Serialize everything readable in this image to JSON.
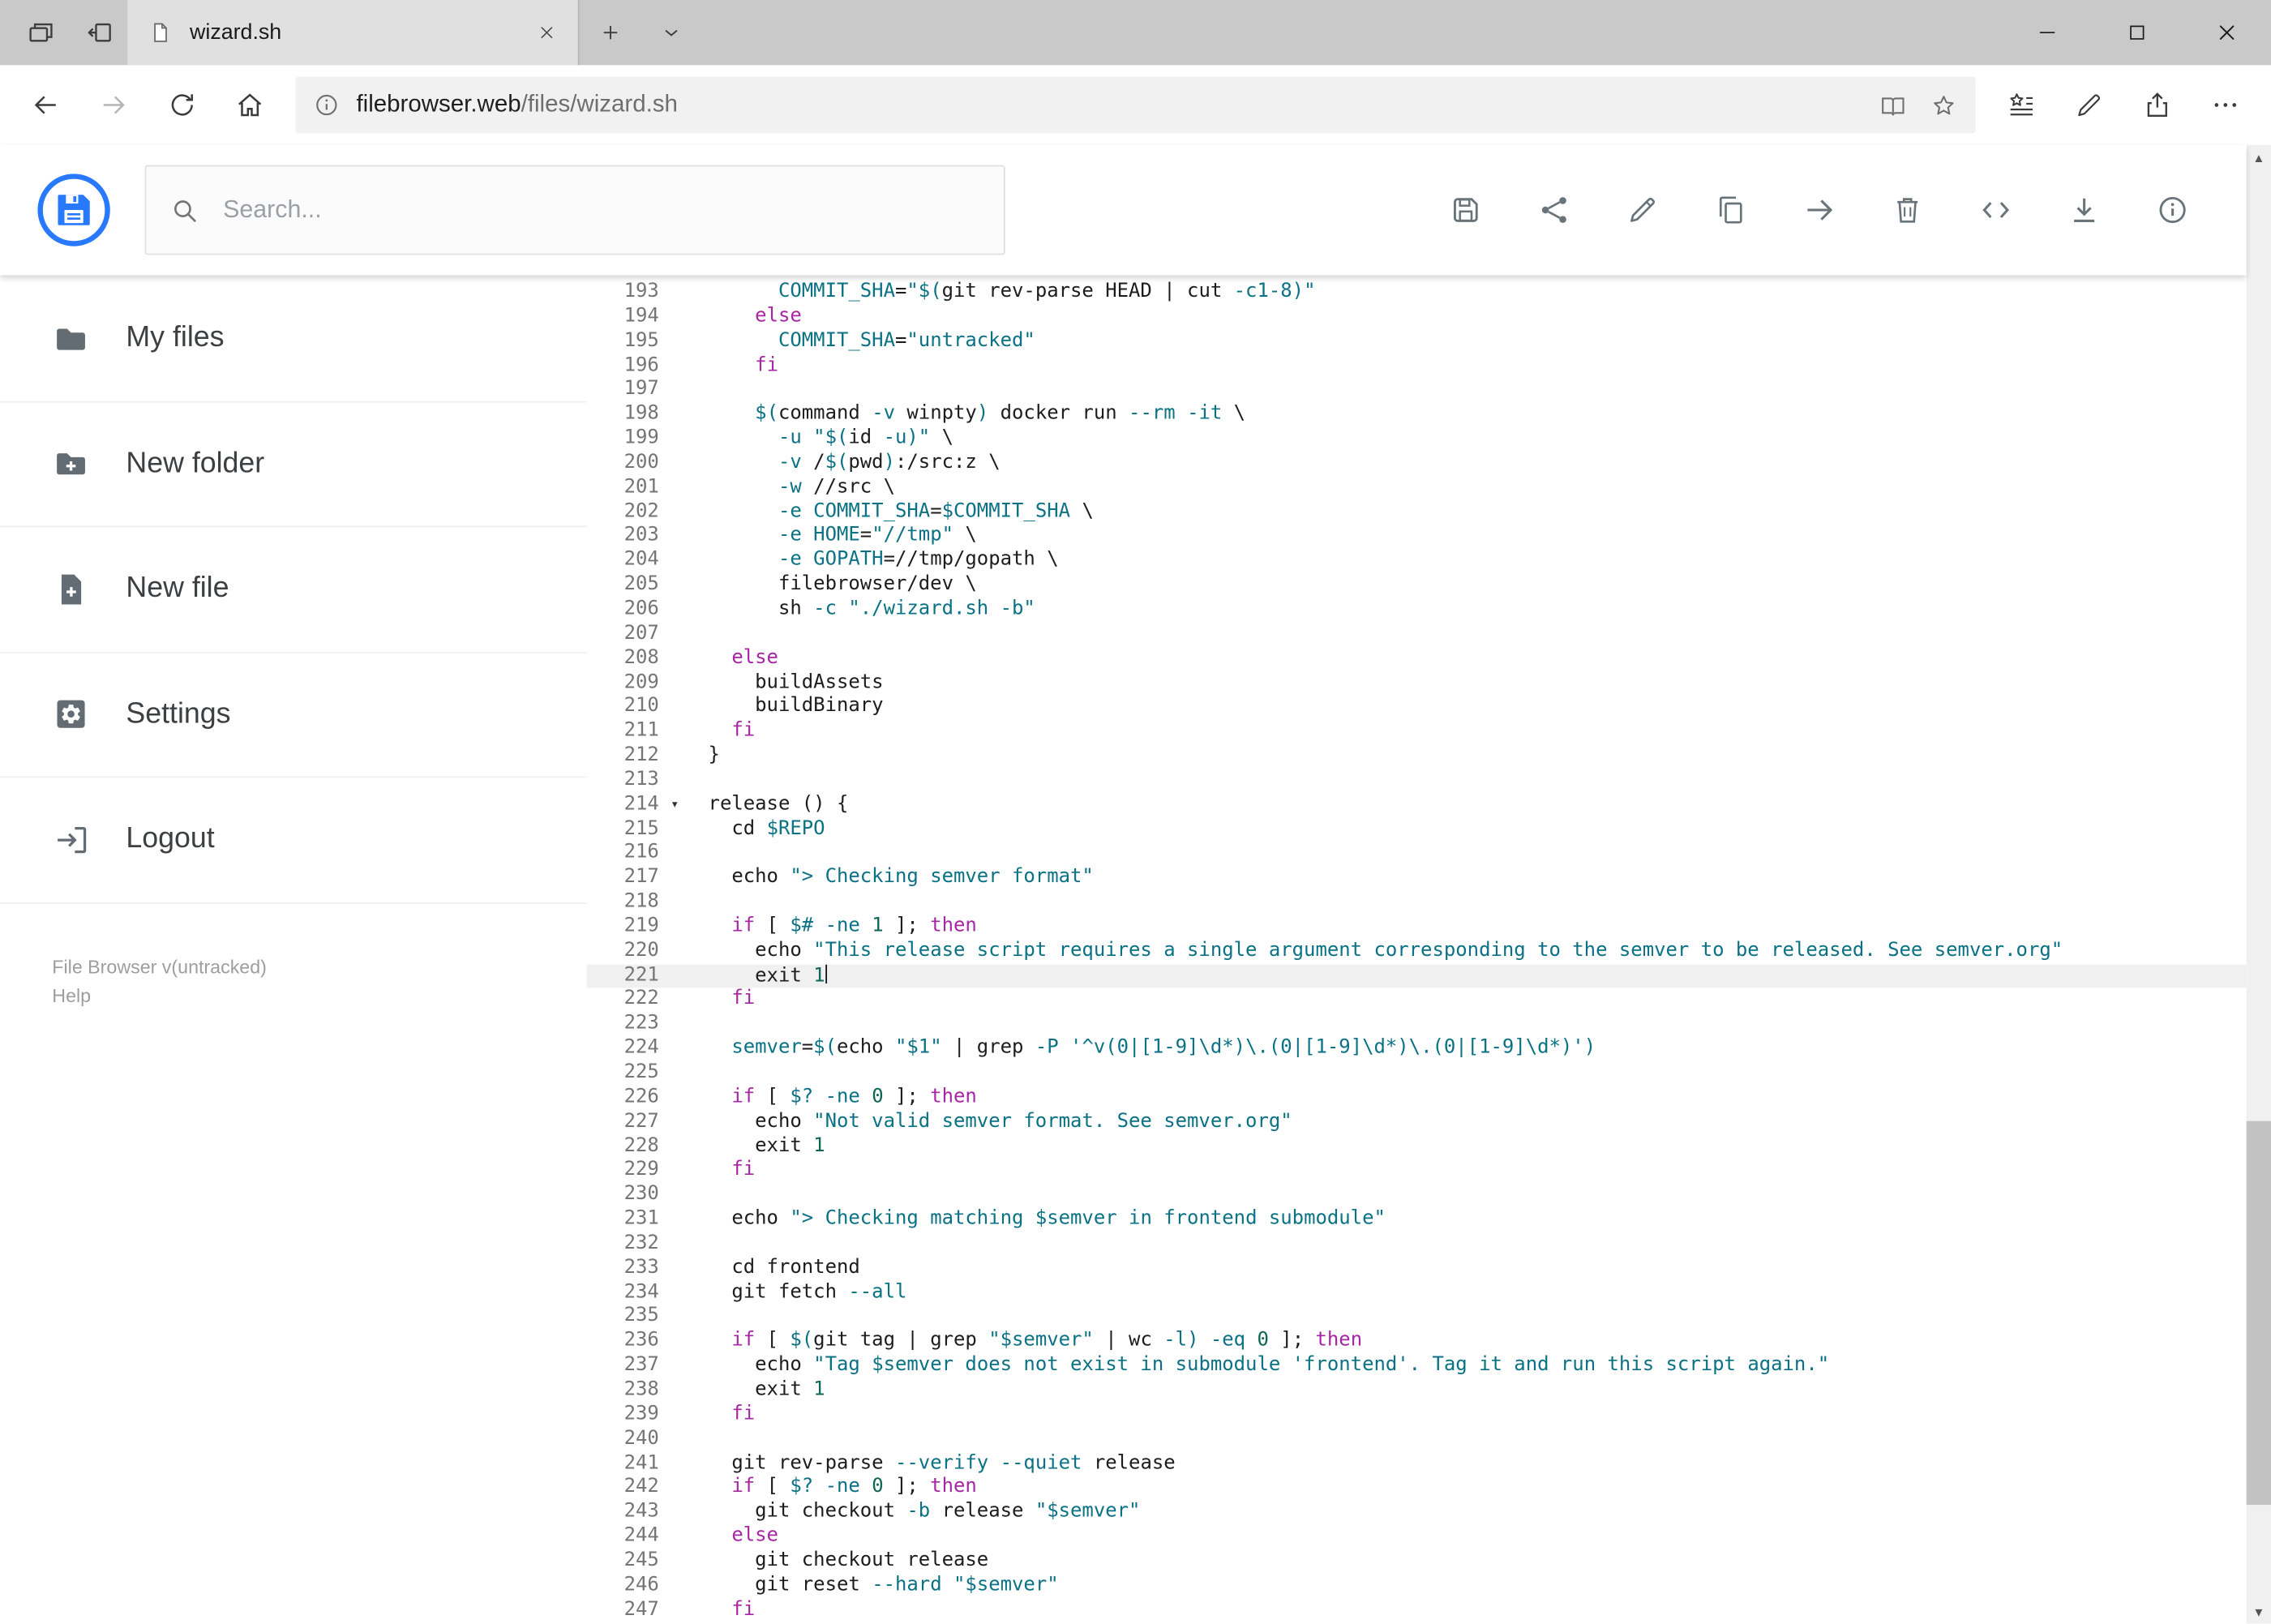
{
  "theme": {
    "accent": "#2979ff",
    "icon_gray": "#69737a",
    "keyword": "#a626a4",
    "string": "#0b7285",
    "variable": "#0b7285",
    "number": "#0e6655",
    "plain": "#1d1d1d",
    "active_line": "#f0f0f0"
  },
  "browser": {
    "tab_title": "wizard.sh",
    "url_host": "filebrowser.web",
    "url_path": "/files/wizard.sh",
    "tab_strip_icons": [
      {
        "name": "tab-preview-button",
        "icon": "tabs-stack"
      },
      {
        "name": "set-tabs-aside-button",
        "icon": "tab-aside"
      }
    ],
    "tab_new_icons": [
      {
        "name": "new-tab-button",
        "icon": "plus"
      },
      {
        "name": "tab-list-button",
        "icon": "chevron-down"
      }
    ],
    "window_icons": [
      {
        "name": "minimize-button",
        "icon": "minimize"
      },
      {
        "name": "maximize-button",
        "icon": "maximize"
      },
      {
        "name": "close-window-button",
        "icon": "close"
      }
    ],
    "nav_icons": [
      {
        "name": "back-button",
        "icon": "back"
      },
      {
        "name": "forward-button",
        "icon": "forward",
        "disabled": true
      },
      {
        "name": "refresh-button",
        "icon": "refresh"
      },
      {
        "name": "home-button",
        "icon": "home"
      }
    ],
    "action_icons": [
      {
        "name": "hub-favorites-button",
        "icon": "hub"
      },
      {
        "name": "web-note-button",
        "icon": "pen"
      },
      {
        "name": "share-page-button",
        "icon": "share-chrome"
      },
      {
        "name": "more-button",
        "icon": "ellipsis"
      }
    ]
  },
  "app": {
    "search_placeholder": "Search...",
    "toolbar": [
      {
        "name": "save-button",
        "icon": "save"
      },
      {
        "name": "share-button",
        "icon": "share"
      },
      {
        "name": "edit-button",
        "icon": "edit"
      },
      {
        "name": "copy-button",
        "icon": "copy"
      },
      {
        "name": "move-button",
        "icon": "move"
      },
      {
        "name": "delete-button",
        "icon": "delete"
      },
      {
        "name": "source-button",
        "icon": "code"
      },
      {
        "name": "download-button",
        "icon": "download"
      },
      {
        "name": "info-button",
        "icon": "info"
      }
    ],
    "sidebar": {
      "items": [
        {
          "id": "my-files",
          "icon": "folder",
          "label": "My files"
        },
        {
          "id": "new-folder",
          "icon": "folder-plus",
          "label": "New folder"
        },
        {
          "id": "new-file",
          "icon": "file-plus",
          "label": "New file"
        },
        {
          "id": "settings",
          "icon": "settings",
          "label": "Settings"
        },
        {
          "id": "logout",
          "icon": "logout",
          "label": "Logout"
        }
      ],
      "footer_version": "File Browser v(untracked)",
      "footer_help": "Help"
    }
  },
  "editor": {
    "active_line": 221,
    "cursor_line": 221,
    "fold_lines": [
      214
    ],
    "lines": [
      {
        "n": 193,
        "t": [
          [
            "p",
            "      "
          ],
          [
            "v",
            "COMMIT_SHA"
          ],
          [
            "p",
            "="
          ],
          [
            "s",
            "\"$("
          ],
          [
            "p",
            "git rev-parse HEAD | cut "
          ],
          [
            "v",
            "-c1-8"
          ],
          [
            "s",
            ")\""
          ]
        ]
      },
      {
        "n": 194,
        "t": [
          [
            "p",
            "    "
          ],
          [
            "k",
            "else"
          ]
        ]
      },
      {
        "n": 195,
        "t": [
          [
            "p",
            "      "
          ],
          [
            "v",
            "COMMIT_SHA"
          ],
          [
            "p",
            "="
          ],
          [
            "s",
            "\"untracked\""
          ]
        ]
      },
      {
        "n": 196,
        "t": [
          [
            "p",
            "    "
          ],
          [
            "k",
            "fi"
          ]
        ]
      },
      {
        "n": 197,
        "t": []
      },
      {
        "n": 198,
        "t": [
          [
            "p",
            "    "
          ],
          [
            "v",
            "$("
          ],
          [
            "p",
            "command "
          ],
          [
            "v",
            "-v"
          ],
          [
            "p",
            " winpty"
          ],
          [
            "v",
            ")"
          ],
          [
            "p",
            " docker run "
          ],
          [
            "v",
            "--rm"
          ],
          [
            "p",
            " "
          ],
          [
            "v",
            "-it"
          ],
          [
            "p",
            " \\"
          ]
        ]
      },
      {
        "n": 199,
        "t": [
          [
            "p",
            "      "
          ],
          [
            "v",
            "-u"
          ],
          [
            "p",
            " "
          ],
          [
            "s",
            "\"$("
          ],
          [
            "p",
            "id "
          ],
          [
            "v",
            "-u"
          ],
          [
            "s",
            ")\""
          ],
          [
            "p",
            " \\"
          ]
        ]
      },
      {
        "n": 200,
        "t": [
          [
            "p",
            "      "
          ],
          [
            "v",
            "-v"
          ],
          [
            "p",
            " /"
          ],
          [
            "v",
            "$("
          ],
          [
            "p",
            "pwd"
          ],
          [
            "v",
            ")"
          ],
          [
            "p",
            ":/src:z \\"
          ]
        ]
      },
      {
        "n": 201,
        "t": [
          [
            "p",
            "      "
          ],
          [
            "v",
            "-w"
          ],
          [
            "p",
            " //src \\"
          ]
        ]
      },
      {
        "n": 202,
        "t": [
          [
            "p",
            "      "
          ],
          [
            "v",
            "-e"
          ],
          [
            "p",
            " "
          ],
          [
            "v",
            "COMMIT_SHA"
          ],
          [
            "p",
            "="
          ],
          [
            "v",
            "$COMMIT_SHA"
          ],
          [
            "p",
            " \\"
          ]
        ]
      },
      {
        "n": 203,
        "t": [
          [
            "p",
            "      "
          ],
          [
            "v",
            "-e"
          ],
          [
            "p",
            " "
          ],
          [
            "v",
            "HOME"
          ],
          [
            "p",
            "="
          ],
          [
            "s",
            "\"//tmp\""
          ],
          [
            "p",
            " \\"
          ]
        ]
      },
      {
        "n": 204,
        "t": [
          [
            "p",
            "      "
          ],
          [
            "v",
            "-e"
          ],
          [
            "p",
            " "
          ],
          [
            "v",
            "GOPATH"
          ],
          [
            "p",
            "=//tmp/gopath \\"
          ]
        ]
      },
      {
        "n": 205,
        "t": [
          [
            "p",
            "      filebrowser/dev \\"
          ]
        ]
      },
      {
        "n": 206,
        "t": [
          [
            "p",
            "      sh "
          ],
          [
            "v",
            "-c"
          ],
          [
            "p",
            " "
          ],
          [
            "s",
            "\"./wizard.sh -b\""
          ]
        ]
      },
      {
        "n": 207,
        "t": []
      },
      {
        "n": 208,
        "t": [
          [
            "p",
            "  "
          ],
          [
            "k",
            "else"
          ]
        ]
      },
      {
        "n": 209,
        "t": [
          [
            "p",
            "    buildAssets"
          ]
        ]
      },
      {
        "n": 210,
        "t": [
          [
            "p",
            "    buildBinary"
          ]
        ]
      },
      {
        "n": 211,
        "t": [
          [
            "p",
            "  "
          ],
          [
            "k",
            "fi"
          ]
        ]
      },
      {
        "n": 212,
        "t": [
          [
            "p",
            "}"
          ]
        ]
      },
      {
        "n": 213,
        "t": []
      },
      {
        "n": 214,
        "t": [
          [
            "p",
            "release () {"
          ]
        ]
      },
      {
        "n": 215,
        "t": [
          [
            "p",
            "  cd "
          ],
          [
            "v",
            "$REPO"
          ]
        ]
      },
      {
        "n": 216,
        "t": []
      },
      {
        "n": 217,
        "t": [
          [
            "p",
            "  echo "
          ],
          [
            "s",
            "\"> Checking semver format\""
          ]
        ]
      },
      {
        "n": 218,
        "t": []
      },
      {
        "n": 219,
        "t": [
          [
            "p",
            "  "
          ],
          [
            "k",
            "if"
          ],
          [
            "p",
            " [ "
          ],
          [
            "v",
            "$#"
          ],
          [
            "p",
            " "
          ],
          [
            "v",
            "-ne"
          ],
          [
            "p",
            " "
          ],
          [
            "n",
            "1"
          ],
          [
            "p",
            " ]; "
          ],
          [
            "k",
            "then"
          ]
        ]
      },
      {
        "n": 220,
        "t": [
          [
            "p",
            "    echo "
          ],
          [
            "s",
            "\"This release script requires a single argument corresponding to the semver to be released. See semver.org\""
          ]
        ]
      },
      {
        "n": 221,
        "t": [
          [
            "p",
            "    exit "
          ],
          [
            "n",
            "1"
          ]
        ]
      },
      {
        "n": 222,
        "t": [
          [
            "p",
            "  "
          ],
          [
            "k",
            "fi"
          ]
        ]
      },
      {
        "n": 223,
        "t": []
      },
      {
        "n": 224,
        "t": [
          [
            "p",
            "  "
          ],
          [
            "v",
            "semver"
          ],
          [
            "p",
            "="
          ],
          [
            "v",
            "$("
          ],
          [
            "p",
            "echo "
          ],
          [
            "s",
            "\"$1\""
          ],
          [
            "p",
            " | grep "
          ],
          [
            "v",
            "-P"
          ],
          [
            "p",
            " "
          ],
          [
            "s",
            "'^v(0|[1-9]\\d*)\\.(0|[1-9]\\d*)\\.(0|[1-9]\\d*)'"
          ],
          [
            "v",
            ")"
          ]
        ]
      },
      {
        "n": 225,
        "t": []
      },
      {
        "n": 226,
        "t": [
          [
            "p",
            "  "
          ],
          [
            "k",
            "if"
          ],
          [
            "p",
            " [ "
          ],
          [
            "v",
            "$?"
          ],
          [
            "p",
            " "
          ],
          [
            "v",
            "-ne"
          ],
          [
            "p",
            " "
          ],
          [
            "n",
            "0"
          ],
          [
            "p",
            " ]; "
          ],
          [
            "k",
            "then"
          ]
        ]
      },
      {
        "n": 227,
        "t": [
          [
            "p",
            "    echo "
          ],
          [
            "s",
            "\"Not valid semver format. See semver.org\""
          ]
        ]
      },
      {
        "n": 228,
        "t": [
          [
            "p",
            "    exit "
          ],
          [
            "n",
            "1"
          ]
        ]
      },
      {
        "n": 229,
        "t": [
          [
            "p",
            "  "
          ],
          [
            "k",
            "fi"
          ]
        ]
      },
      {
        "n": 230,
        "t": []
      },
      {
        "n": 231,
        "t": [
          [
            "p",
            "  echo "
          ],
          [
            "s",
            "\"> Checking matching "
          ],
          [
            "v",
            "$semver"
          ],
          [
            "s",
            " in frontend submodule\""
          ]
        ]
      },
      {
        "n": 232,
        "t": []
      },
      {
        "n": 233,
        "t": [
          [
            "p",
            "  cd frontend"
          ]
        ]
      },
      {
        "n": 234,
        "t": [
          [
            "p",
            "  git fetch "
          ],
          [
            "v",
            "--all"
          ]
        ]
      },
      {
        "n": 235,
        "t": []
      },
      {
        "n": 236,
        "t": [
          [
            "p",
            "  "
          ],
          [
            "k",
            "if"
          ],
          [
            "p",
            " [ "
          ],
          [
            "v",
            "$("
          ],
          [
            "p",
            "git tag | grep "
          ],
          [
            "s",
            "\"$semver\""
          ],
          [
            "p",
            " | wc "
          ],
          [
            "v",
            "-l)"
          ],
          [
            "p",
            " "
          ],
          [
            "v",
            "-eq"
          ],
          [
            "p",
            " "
          ],
          [
            "n",
            "0"
          ],
          [
            "p",
            " ]; "
          ],
          [
            "k",
            "then"
          ]
        ]
      },
      {
        "n": 237,
        "t": [
          [
            "p",
            "    echo "
          ],
          [
            "s",
            "\"Tag "
          ],
          [
            "v",
            "$semver"
          ],
          [
            "s",
            " does not exist in submodule 'frontend'. Tag it and run this script again.\""
          ]
        ]
      },
      {
        "n": 238,
        "t": [
          [
            "p",
            "    exit "
          ],
          [
            "n",
            "1"
          ]
        ]
      },
      {
        "n": 239,
        "t": [
          [
            "p",
            "  "
          ],
          [
            "k",
            "fi"
          ]
        ]
      },
      {
        "n": 240,
        "t": []
      },
      {
        "n": 241,
        "t": [
          [
            "p",
            "  git rev-parse "
          ],
          [
            "v",
            "--verify"
          ],
          [
            "p",
            " "
          ],
          [
            "v",
            "--quiet"
          ],
          [
            "p",
            " release"
          ]
        ]
      },
      {
        "n": 242,
        "t": [
          [
            "p",
            "  "
          ],
          [
            "k",
            "if"
          ],
          [
            "p",
            " [ "
          ],
          [
            "v",
            "$?"
          ],
          [
            "p",
            " "
          ],
          [
            "v",
            "-ne"
          ],
          [
            "p",
            " "
          ],
          [
            "n",
            "0"
          ],
          [
            "p",
            " ]; "
          ],
          [
            "k",
            "then"
          ]
        ]
      },
      {
        "n": 243,
        "t": [
          [
            "p",
            "    git checkout "
          ],
          [
            "v",
            "-b"
          ],
          [
            "p",
            " release "
          ],
          [
            "s",
            "\"$semver\""
          ]
        ]
      },
      {
        "n": 244,
        "t": [
          [
            "p",
            "  "
          ],
          [
            "k",
            "else"
          ]
        ]
      },
      {
        "n": 245,
        "t": [
          [
            "p",
            "    git checkout release"
          ]
        ]
      },
      {
        "n": 246,
        "t": [
          [
            "p",
            "    git reset "
          ],
          [
            "v",
            "--hard"
          ],
          [
            "p",
            " "
          ],
          [
            "s",
            "\"$semver\""
          ]
        ]
      },
      {
        "n": 247,
        "t": [
          [
            "p",
            "  "
          ],
          [
            "k",
            "fi"
          ]
        ]
      }
    ]
  }
}
